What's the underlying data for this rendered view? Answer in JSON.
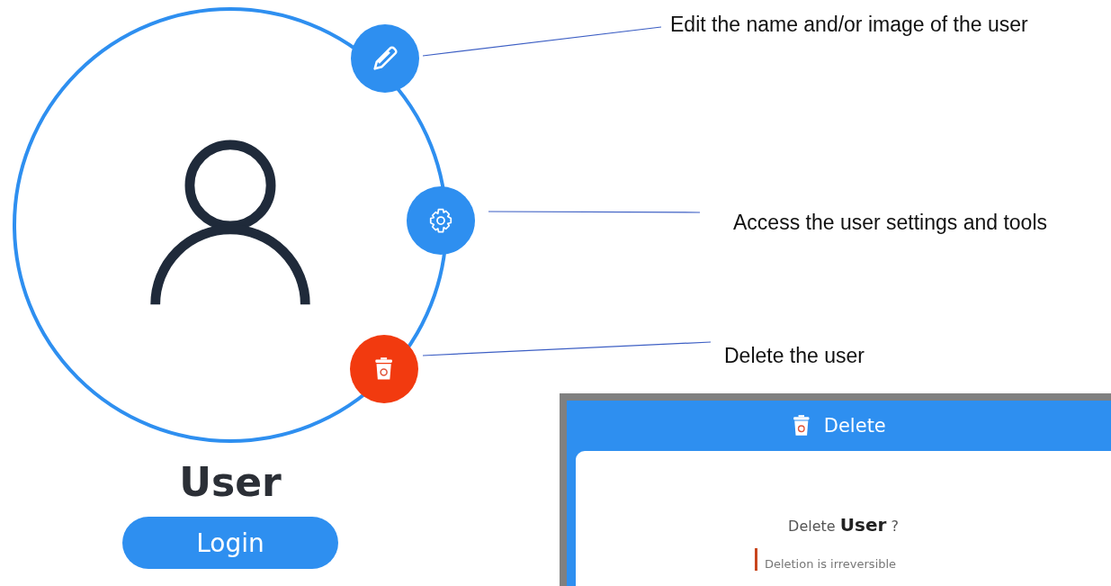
{
  "profile": {
    "name": "User",
    "login_button": "Login"
  },
  "actions": [
    {
      "kind": "edit",
      "color": "#2e8ff0",
      "annotation": "Edit the name and/or image of the user"
    },
    {
      "kind": "settings",
      "color": "#2e8ff0",
      "annotation": "Access the user settings and tools"
    },
    {
      "kind": "delete",
      "color": "#f23a0f",
      "annotation": "Delete the user"
    }
  ],
  "dialog": {
    "title": "Delete",
    "question": "Delete **User** ?",
    "warning": "Deletion is irreversible"
  }
}
